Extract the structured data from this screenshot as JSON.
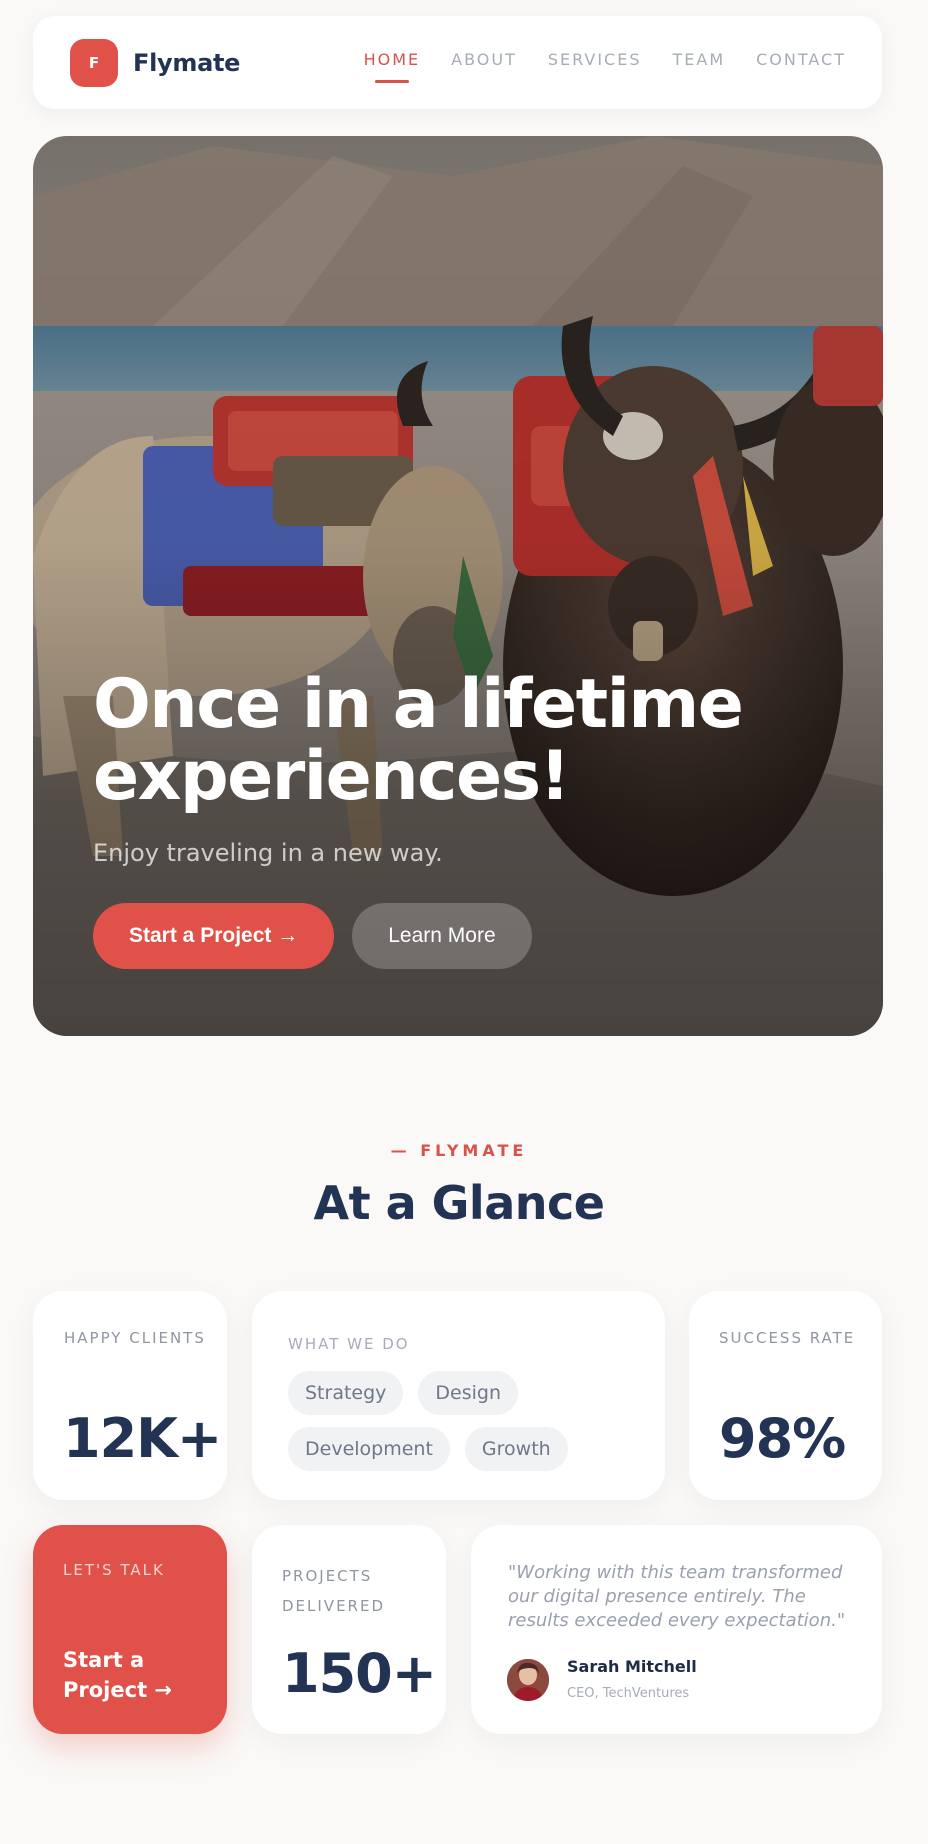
{
  "nav": {
    "logo_letter": "F",
    "brand": "Flymate",
    "links": [
      {
        "label": "HOME",
        "active": true
      },
      {
        "label": "ABOUT",
        "active": false
      },
      {
        "label": "SERVICES",
        "active": false
      },
      {
        "label": "TEAM",
        "active": false
      },
      {
        "label": "CONTACT",
        "active": false
      }
    ]
  },
  "hero": {
    "title_line1": "Once in a lifetime",
    "title_line2": "experiences!",
    "subtitle": "Enjoy traveling in a new way.",
    "primary_button": "Start a Project →",
    "secondary_button": "Learn More"
  },
  "glance": {
    "eyebrow": "— FLYMATE",
    "title": "At a Glance",
    "happy_clients": {
      "label": "HAPPY CLIENTS",
      "value": "12K+"
    },
    "what_we_do": {
      "label": "WHAT WE DO",
      "tags": [
        "Strategy",
        "Design",
        "Development",
        "Growth"
      ]
    },
    "success_rate": {
      "label": "SUCCESS RATE",
      "value": "98%"
    },
    "lets_talk": {
      "label": "LET'S TALK",
      "cta": "Start a Project →"
    },
    "projects": {
      "label": "PROJECTS DELIVERED",
      "value": "150+"
    },
    "testimonial": {
      "quote": "\"Working with this team transformed our digital presence entirely. The results exceeded every expectation.\"",
      "name": "Sarah Mitchell",
      "role": "CEO, TechVentures"
    }
  },
  "colors": {
    "accent": "#e05149",
    "navy": "#223354",
    "background": "#faf9f7"
  }
}
